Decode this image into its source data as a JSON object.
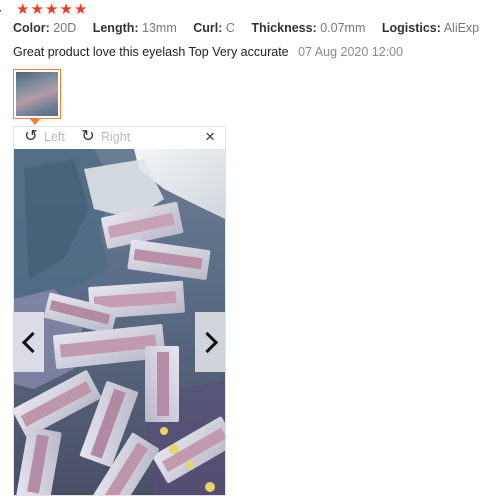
{
  "review": {
    "reviewer_fragment": "r",
    "rating": 5,
    "attributes": [
      {
        "key": "Color:",
        "value": "20D"
      },
      {
        "key": "Length:",
        "value": "13mm"
      },
      {
        "key": "Curl:",
        "value": "C"
      },
      {
        "key": "Thickness:",
        "value": "0.07mm"
      },
      {
        "key": "Logistics:",
        "value": "AliExpre"
      }
    ],
    "text": "Great product love this eyelash Top Very accurate",
    "date": "07 Aug 2020 12:00"
  },
  "viewer": {
    "rotate_left_label": "Left",
    "rotate_right_label": "Right",
    "close_glyph": "×",
    "rotate_left_icon": "rotate-ccw-icon",
    "rotate_right_icon": "rotate-cw-icon"
  },
  "colors": {
    "star": "#f23b27",
    "thumb_border": "#ff7e2e",
    "muted_text": "#bbbbbb"
  }
}
